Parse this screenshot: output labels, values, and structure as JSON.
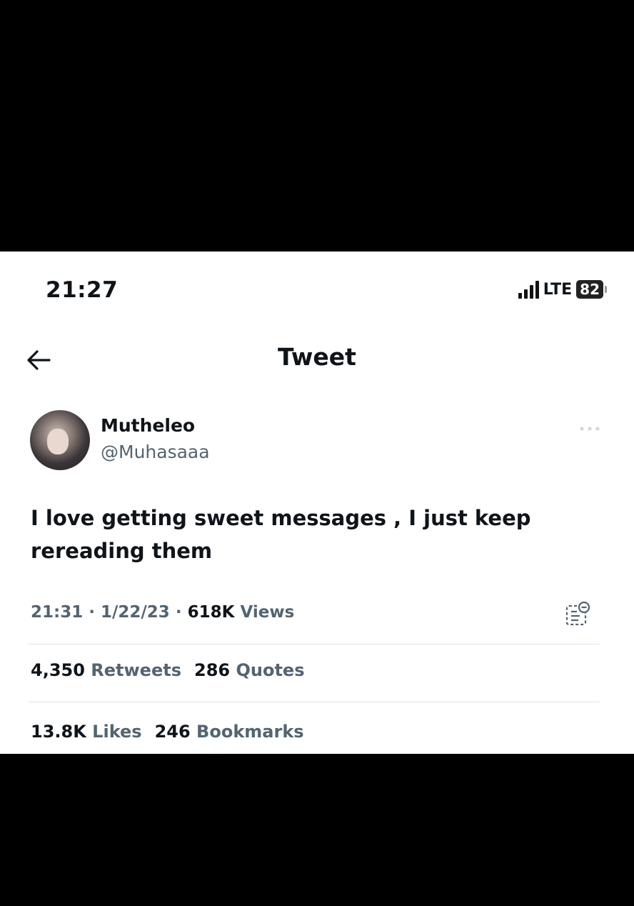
{
  "status_bar": {
    "time": "21:27",
    "network": "LTE",
    "battery": "82"
  },
  "header": {
    "title": "Tweet",
    "back_icon": "arrow-left-icon"
  },
  "author": {
    "name": "Mutheleo",
    "handle": "@Muhasaaa"
  },
  "tweet": {
    "text": "I love getting sweet messages , I just keep rereading them"
  },
  "meta": {
    "time": "21:31",
    "date": "1/22/23",
    "views_count": "618K",
    "views_label": "Views"
  },
  "stats_row1": [
    {
      "count": "4,350",
      "label": "Retweets"
    },
    {
      "count": "286",
      "label": "Quotes"
    }
  ],
  "stats_row2": [
    {
      "count": "13.8K",
      "label": "Likes"
    },
    {
      "count": "246",
      "label": "Bookmarks"
    }
  ]
}
